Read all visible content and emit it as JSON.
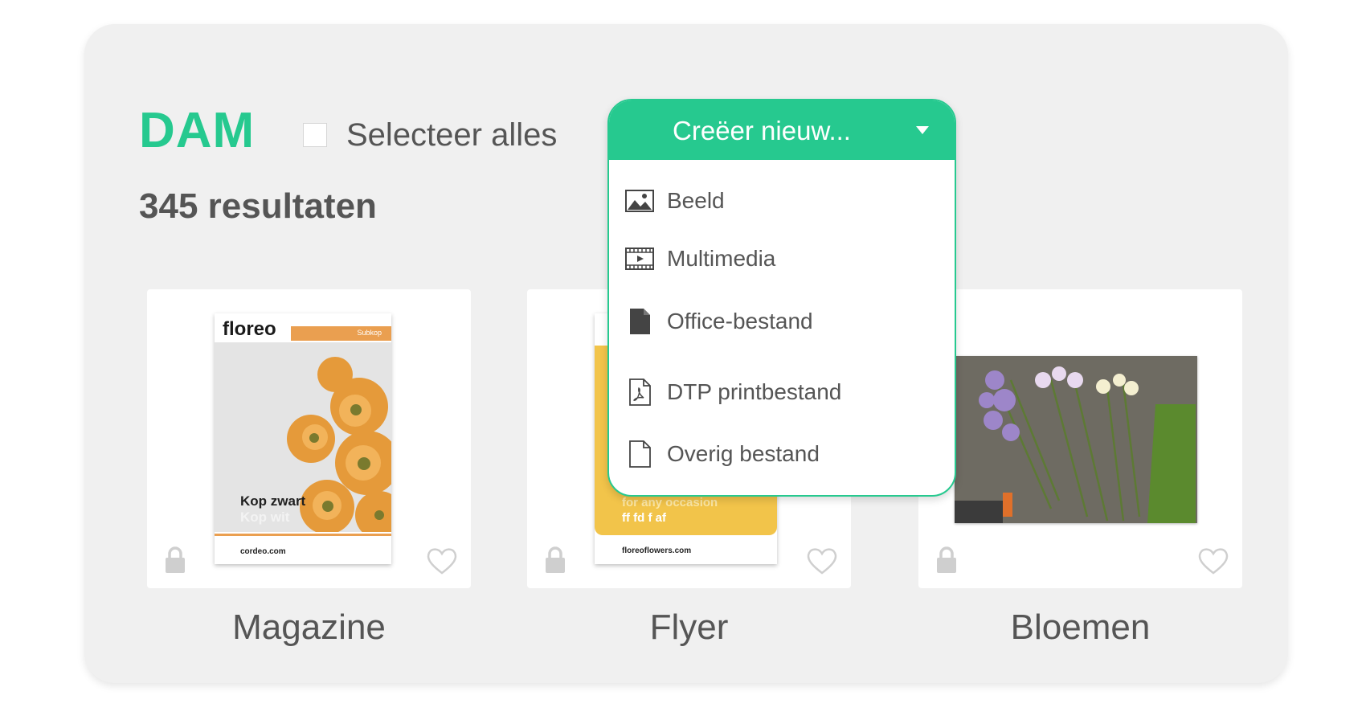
{
  "header": {
    "title": "DAM",
    "select_all_label": "Selecteer alles",
    "results_label": "345 resultaten"
  },
  "create_dropdown": {
    "label": "Creëer nieuw...",
    "items": [
      {
        "label": "Beeld",
        "icon": "image-icon"
      },
      {
        "label": "Multimedia",
        "icon": "film-icon"
      },
      {
        "label": "Office-bestand",
        "icon": "document-filled-icon"
      },
      {
        "label": "DTP printbestand",
        "icon": "pdf-file-icon"
      },
      {
        "label": "Overig bestand",
        "icon": "blank-file-icon"
      }
    ]
  },
  "assets": [
    {
      "caption": "Magazine",
      "locked": true,
      "favorite": false
    },
    {
      "caption": "Flyer",
      "locked": true,
      "favorite": false
    },
    {
      "caption": "Bloemen",
      "locked": true,
      "favorite": false
    }
  ],
  "thumbnails": {
    "magazine": {
      "logo": "floreo",
      "subhead": "Subkop",
      "headline_dark": "Kop zwart",
      "headline_light": "Kop wit",
      "url": "cordeo.com"
    },
    "flyer": {
      "line1": "for any occasion",
      "line2": "ff fd f af",
      "url": "floreoflowers.com"
    }
  },
  "colors": {
    "accent": "#26c98f",
    "panel": "#f0f0f0",
    "text": "#555555",
    "magazine_orange": "#ea9f50",
    "flyer_yellow": "#f2c44a"
  }
}
